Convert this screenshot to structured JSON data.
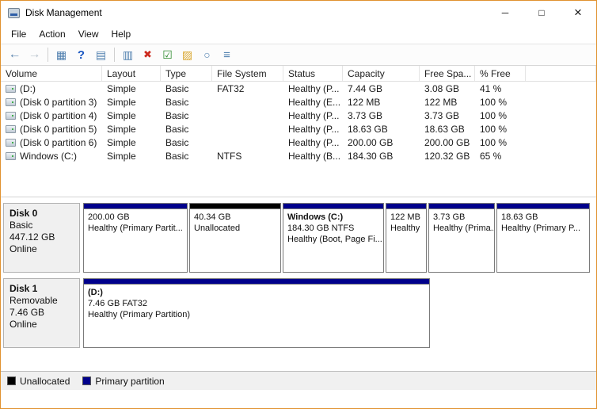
{
  "window": {
    "title": "Disk Management",
    "controls": {
      "minimize": "─",
      "maximize": "□",
      "close": "×"
    }
  },
  "menu": {
    "items": [
      "File",
      "Action",
      "View",
      "Help"
    ]
  },
  "toolbar": {
    "icons": [
      {
        "name": "back-icon",
        "glyph": "←",
        "color": "#5f87b0"
      },
      {
        "name": "forward-icon",
        "glyph": "→",
        "color": "#b9c3cd"
      },
      {
        "name": "separator",
        "glyph": ""
      },
      {
        "name": "console-tree-icon",
        "glyph": "▦",
        "color": "#4f7fae"
      },
      {
        "name": "help-icon",
        "glyph": "?",
        "color": "#1a57c2"
      },
      {
        "name": "action-pane-icon",
        "glyph": "▤",
        "color": "#4f7fae"
      },
      {
        "name": "separator",
        "glyph": ""
      },
      {
        "name": "properties-icon",
        "glyph": "▥",
        "color": "#4f7fae"
      },
      {
        "name": "delete-volume-icon",
        "glyph": "✖",
        "color": "#cc2a1e"
      },
      {
        "name": "mark-partition-icon",
        "glyph": "☑",
        "color": "#2e8b2e"
      },
      {
        "name": "open-folder-icon",
        "glyph": "▨",
        "color": "#d9a62e"
      },
      {
        "name": "explore-icon",
        "glyph": "○",
        "color": "#4f7fae"
      },
      {
        "name": "view-list-icon",
        "glyph": "≡",
        "color": "#4f7fae"
      }
    ]
  },
  "volume_table": {
    "columns": [
      "Volume",
      "Layout",
      "Type",
      "File System",
      "Status",
      "Capacity",
      "Free Spa...",
      "% Free"
    ],
    "rows": [
      {
        "volume": "(D:)",
        "layout": "Simple",
        "type": "Basic",
        "fs": "FAT32",
        "status": "Healthy (P...",
        "capacity": "7.44 GB",
        "free": "3.08 GB",
        "pct": "41 %"
      },
      {
        "volume": "(Disk 0 partition 3)",
        "layout": "Simple",
        "type": "Basic",
        "fs": "",
        "status": "Healthy (E...",
        "capacity": "122 MB",
        "free": "122 MB",
        "pct": "100 %"
      },
      {
        "volume": "(Disk 0 partition 4)",
        "layout": "Simple",
        "type": "Basic",
        "fs": "",
        "status": "Healthy (P...",
        "capacity": "3.73 GB",
        "free": "3.73 GB",
        "pct": "100 %"
      },
      {
        "volume": "(Disk 0 partition 5)",
        "layout": "Simple",
        "type": "Basic",
        "fs": "",
        "status": "Healthy (P...",
        "capacity": "18.63 GB",
        "free": "18.63 GB",
        "pct": "100 %"
      },
      {
        "volume": "(Disk 0 partition 6)",
        "layout": "Simple",
        "type": "Basic",
        "fs": "",
        "status": "Healthy (P...",
        "capacity": "200.00 GB",
        "free": "200.00 GB",
        "pct": "100 %"
      },
      {
        "volume": "Windows (C:)",
        "layout": "Simple",
        "type": "Basic",
        "fs": "NTFS",
        "status": "Healthy (B...",
        "capacity": "184.30 GB",
        "free": "120.32 GB",
        "pct": "65 %"
      }
    ]
  },
  "disks": [
    {
      "name": "Disk 0",
      "type": "Basic",
      "size": "447.12 GB",
      "status": "Online",
      "partitions": [
        {
          "title": "",
          "line1": "200.00 GB",
          "line2": "Healthy (Primary Partit...",
          "kind": "primary"
        },
        {
          "title": "",
          "line1": "40.34 GB",
          "line2": "Unallocated",
          "kind": "unallocated"
        },
        {
          "title": "Windows (C:)",
          "line1": "184.30 GB NTFS",
          "line2": "Healthy (Boot, Page Fi...",
          "kind": "primary"
        },
        {
          "title": "",
          "line1": "122 MB",
          "line2": "Healthy",
          "kind": "primary"
        },
        {
          "title": "",
          "line1": "3.73 GB",
          "line2": "Healthy (Prima...",
          "kind": "primary"
        },
        {
          "title": "",
          "line1": "18.63 GB",
          "line2": "Healthy (Primary P...",
          "kind": "primary"
        }
      ]
    },
    {
      "name": "Disk 1",
      "type": "Removable",
      "size": "7.46 GB",
      "status": "Online",
      "partitions": [
        {
          "title": "(D:)",
          "line1": "7.46 GB FAT32",
          "line2": "Healthy (Primary Partition)",
          "kind": "primary"
        }
      ]
    }
  ],
  "legend": {
    "items": [
      {
        "label": "Unallocated",
        "color": "#000000"
      },
      {
        "label": "Primary partition",
        "color": "#00008b"
      }
    ]
  },
  "colors": {
    "accent_border": "#e0922f",
    "primary_partition": "#00008b",
    "unallocated": "#000000"
  }
}
